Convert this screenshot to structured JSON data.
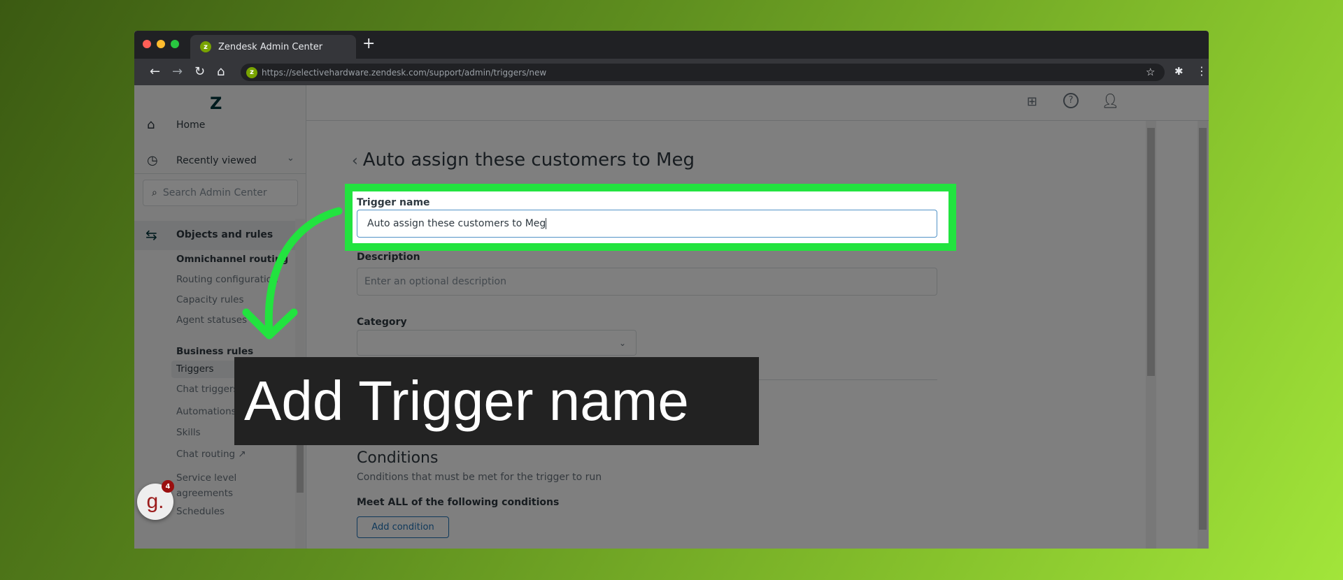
{
  "browser": {
    "tab_title": "Zendesk Admin Center",
    "url": "https://selectivehardware.zendesk.com/support/admin/triggers/new"
  },
  "sidebar": {
    "home": "Home",
    "recently_viewed": "Recently viewed",
    "search_placeholder": "Search Admin Center",
    "section": "Objects and rules",
    "groups": [
      {
        "heading": "Omnichannel routing",
        "items": [
          "Routing configuration",
          "Capacity rules",
          "Agent statuses"
        ]
      },
      {
        "heading": "Business rules",
        "items": [
          "Triggers",
          "Chat triggers",
          "Automations",
          "Skills",
          "Chat routing",
          "Service level agreements",
          "Schedules"
        ]
      }
    ],
    "active_item": "Triggers"
  },
  "page": {
    "title": "Auto assign these customers to Meg",
    "trigger_name_label": "Trigger name",
    "trigger_name_value": "Auto assign these customers to Meg",
    "description_label": "Description",
    "description_placeholder": "Enter an optional description",
    "category_label": "Category",
    "conditions_heading": "Conditions",
    "conditions_subtitle": "Conditions that must be met for the trigger to run",
    "meet_all": "Meet ALL of the following conditions",
    "add_condition": "Add condition"
  },
  "overlay": {
    "caption": "Add Trigger name",
    "highlight_color": "#22e33f",
    "badge_count": "4",
    "widget_letter": "g."
  }
}
